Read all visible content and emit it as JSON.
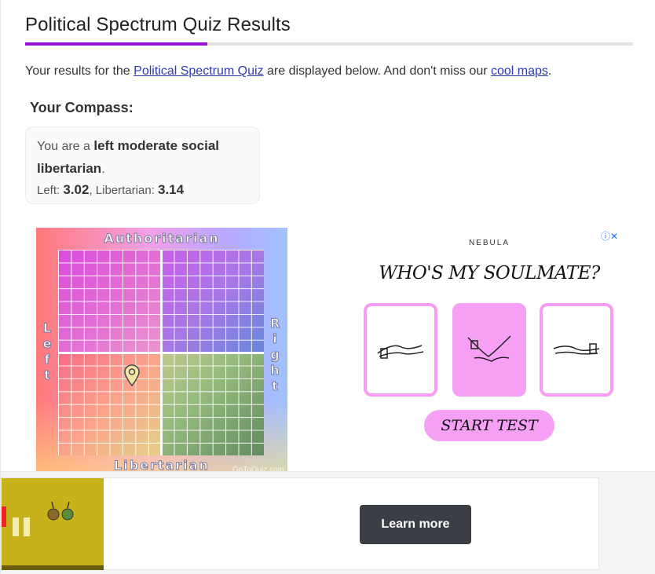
{
  "page": {
    "title": "Political Spectrum Quiz Results",
    "intro": {
      "prefix": "Your results for the ",
      "quiz_link": "Political Spectrum Quiz",
      "middle": " are displayed below. And don't miss our ",
      "maps_link": "cool maps",
      "suffix": "."
    },
    "compass_heading": "Your Compass:",
    "result": {
      "prefix": "You are a ",
      "label": "left moderate social libertarian",
      "suffix": ".",
      "left_label": "Left: ",
      "left_value": "3.02",
      "sep": ", Libertarian: ",
      "lib_value": "3.14"
    },
    "compass": {
      "top": "Authoritarian",
      "bottom": "Libertarian",
      "left": "Left",
      "right": "Right",
      "watermark": "GoToQuiz.com"
    }
  },
  "ad_right": {
    "brand": "NEBULA",
    "headline": "WHO'S MY SOULMATE?",
    "button": "START TEST"
  },
  "ad_bottom": {
    "button": "Learn more"
  },
  "colors": {
    "accent": "#9b10d8",
    "link": "#2a3bb0",
    "ad_pink": "#f5a0f4"
  }
}
